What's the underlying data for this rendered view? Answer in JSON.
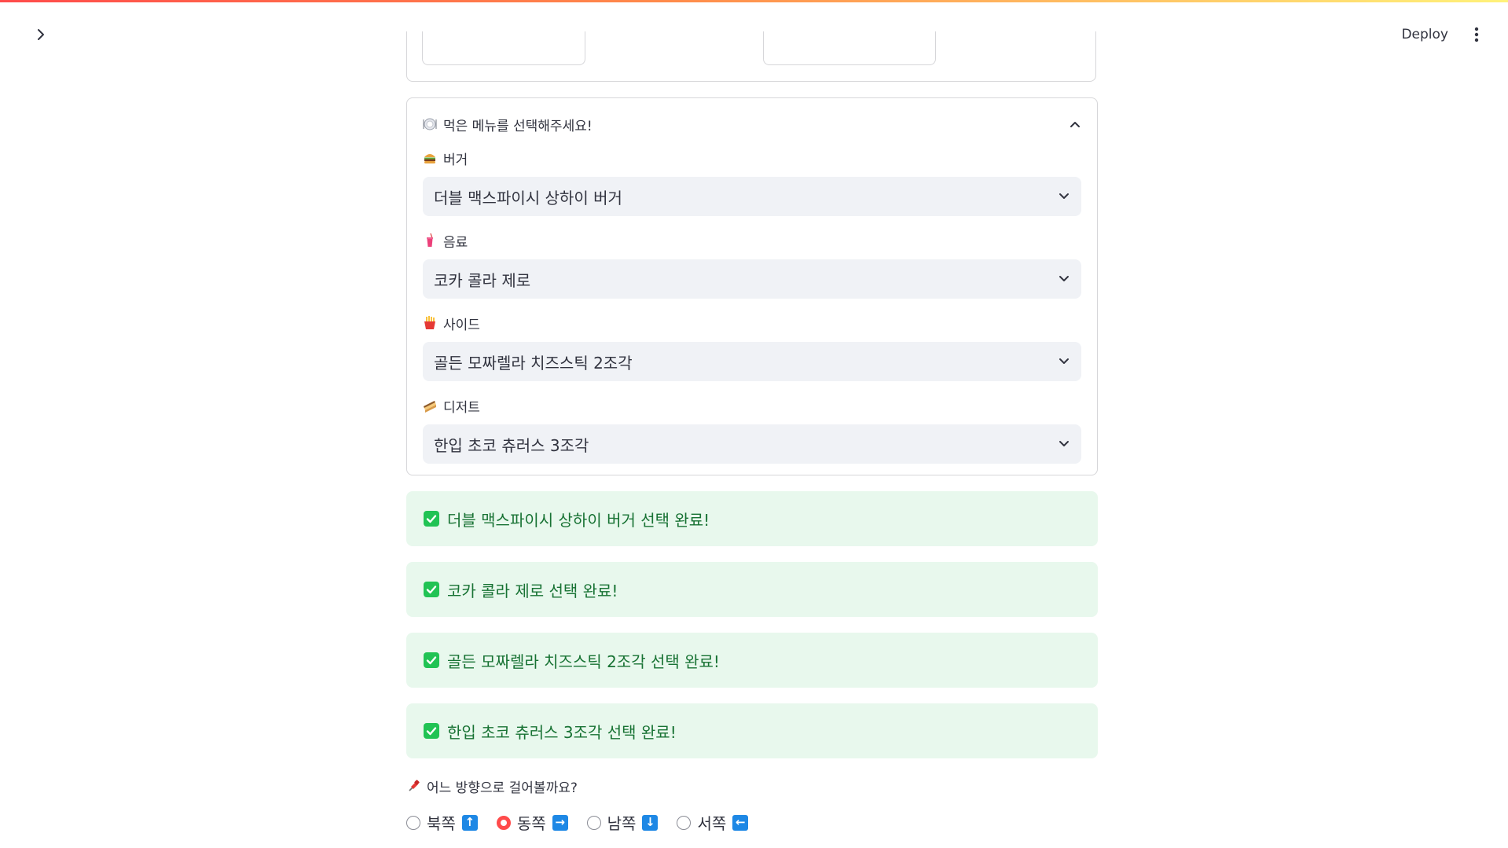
{
  "header": {
    "deploy_label": "Deploy"
  },
  "expander": {
    "title": "먹은 메뉴를 선택해주세요!",
    "fields": [
      {
        "label": "버거",
        "value": "더블 맥스파이시 상하이 버거"
      },
      {
        "label": "음료",
        "value": "코카 콜라 제로"
      },
      {
        "label": "사이드",
        "value": "골든 모짜렐라 치즈스틱 2조각"
      },
      {
        "label": "디저트",
        "value": "한입 초코 츄러스 3조각"
      }
    ]
  },
  "alerts": [
    "더블 맥스파이시 상하이 버거 선택 완료!",
    "코카 콜라 제로 선택 완료!",
    "골든 모짜렐라 치즈스틱 2조각 선택 완료!",
    "한입 초코 츄러스 3조각 선택 완료!"
  ],
  "direction": {
    "label": "어느 방향으로 걸어볼까요?",
    "options": [
      {
        "label": "북쪽",
        "arrow": "↑"
      },
      {
        "label": "동쪽",
        "arrow": "→"
      },
      {
        "label": "남쪽",
        "arrow": "↓"
      },
      {
        "label": "서쪽",
        "arrow": "←"
      }
    ],
    "selected": "동쪽"
  },
  "colors": {
    "accent": "#ff4b4b",
    "success_bg": "#e8f8ed",
    "success_text": "#177233",
    "select_bg": "#f0f2f6",
    "arrow_bg": "#1e88e5"
  }
}
